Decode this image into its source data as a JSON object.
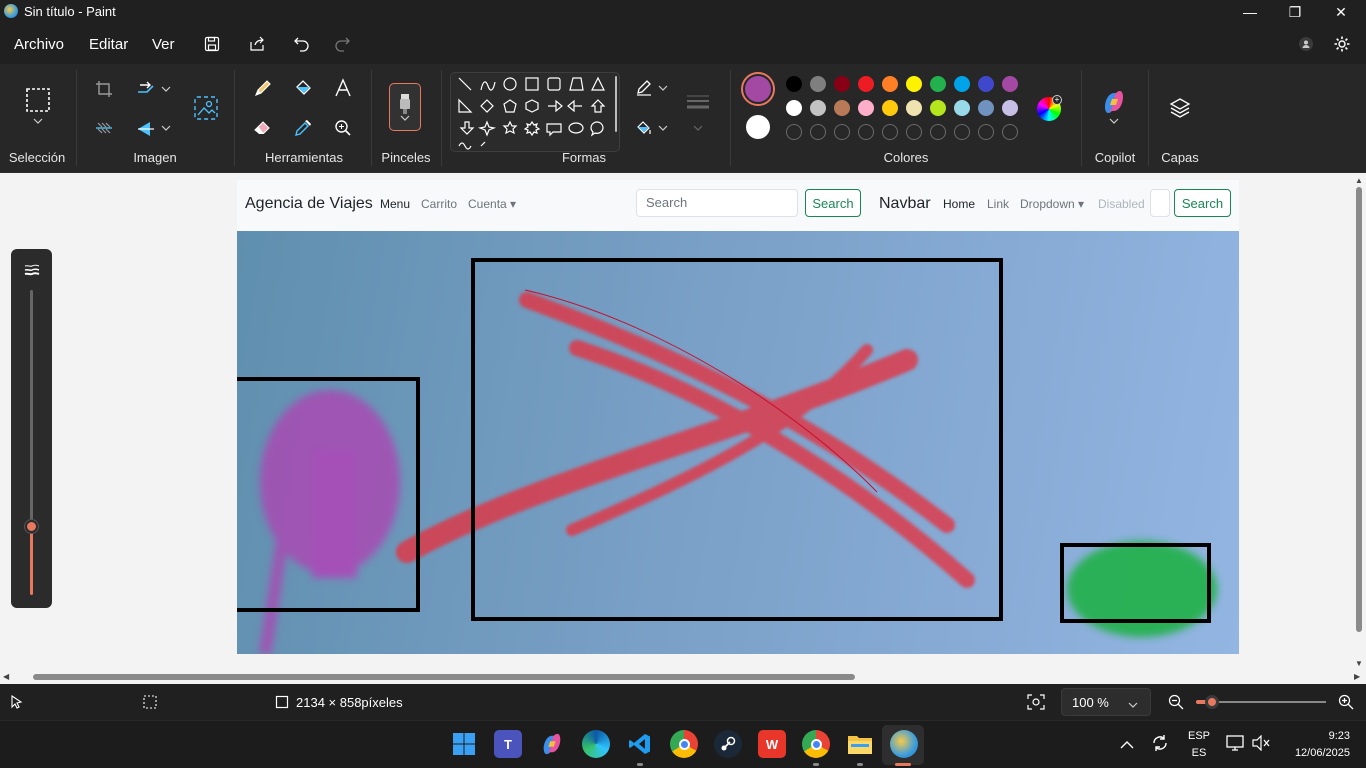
{
  "window": {
    "title": "Sin título - Paint",
    "minimize_glyph": "—",
    "restore_glyph": "❐",
    "close_glyph": "✕"
  },
  "menu": {
    "items": [
      "Archivo",
      "Editar",
      "Ver"
    ]
  },
  "ribbon": {
    "groups": {
      "selection": "Selección",
      "image": "Imagen",
      "tools": "Herramientas",
      "brushes": "Pinceles",
      "shapes": "Formas",
      "colors": "Colores",
      "copilot": "Copilot",
      "layers": "Capas"
    },
    "active_color": "#a349a4",
    "secondary_color": "#ffffff",
    "palette_row1": [
      "#000000",
      "#7f7f7f",
      "#880015",
      "#ed1c24",
      "#ff7f27",
      "#fff200",
      "#22b14c",
      "#00a2e8",
      "#3f48cc",
      "#a349a4"
    ],
    "palette_row2": [
      "#ffffff",
      "#c3c3c3",
      "#b97a57",
      "#ffaec9",
      "#ffc90e",
      "#efe4b0",
      "#b5e61d",
      "#99d9ea",
      "#7092be",
      "#c8bfe7"
    ],
    "palette_row3_empty": 10
  },
  "canvas_page": {
    "brand": "Agencia de Viajes",
    "nav_left": [
      "Menu",
      "Carrito",
      "Cuenta ▾"
    ],
    "search_placeholder": "Search",
    "search_button": "Search",
    "navbar_brand": "Navbar",
    "nav_right": [
      "Home",
      "Link",
      "Dropdown ▾"
    ],
    "nav_disabled": "Disabled",
    "search_button_2": "Search"
  },
  "status": {
    "dimensions": "2134 × 858píxeles",
    "zoom": "100 %",
    "zoom_slider_fraction": 0.12
  },
  "taskbar": {
    "lang_top": "ESP",
    "lang_bottom": "ES",
    "time": "9:23",
    "date": "12/06/2025"
  }
}
